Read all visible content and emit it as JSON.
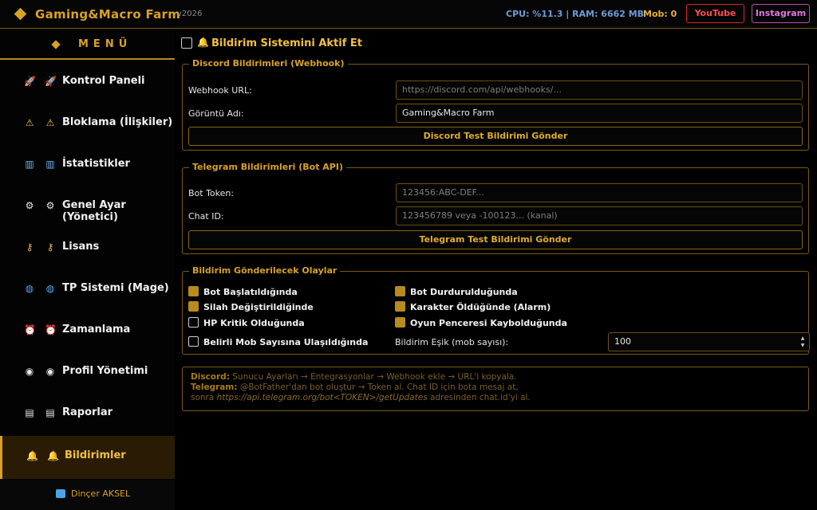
{
  "title_bar": {
    "app_title": "Gaming&Macro Farm",
    "version": "v2026",
    "cpu_ram": "CPU: %11.3 | RAM: 6662 MB",
    "mob": "Mob: 0",
    "youtube_label": "YouTube",
    "instagram_label": "Instagram"
  },
  "sidebar": {
    "menu_title": "MENÜ",
    "items": [
      {
        "icon": "rocket-icon",
        "label": "Kontrol Paneli"
      },
      {
        "icon": "warning-icon",
        "label": "Bloklama (İlişkiler)"
      },
      {
        "icon": "bar-chart-icon",
        "label": "İstatistikler"
      },
      {
        "icon": "gear-icon",
        "label": "Genel Ayar (Yönetici)"
      },
      {
        "icon": "key-icon",
        "label": "Lisans"
      },
      {
        "icon": "globe-icon",
        "label": "TP Sistemi (Mage)"
      },
      {
        "icon": "alarm-clock-icon",
        "label": "Zamanlama"
      },
      {
        "icon": "profile-icon",
        "label": "Profil Yönetimi"
      },
      {
        "icon": "clipboard-icon",
        "label": "Raporlar"
      },
      {
        "icon": "bell-icon",
        "label": "Bildirimler",
        "active": true
      }
    ],
    "user_name": "Dinçer AKSEL"
  },
  "main": {
    "enable_label": "Bildirim Sistemini Aktif Et",
    "enable_checked": false,
    "discord": {
      "title": "Discord Bildirimleri (Webhook)",
      "webhook_label": "Webhook URL:",
      "webhook_placeholder": "https://discord.com/api/webhooks/...",
      "display_name_label": "Görüntü Adı:",
      "display_name_value": "Gaming&Macro Farm",
      "test_button": "Discord Test Bildirimi Gönder"
    },
    "telegram": {
      "title": "Telegram Bildirimleri (Bot API)",
      "token_label": "Bot Token:",
      "token_placeholder": "123456:ABC-DEF...",
      "chat_id_label": "Chat ID:",
      "chat_id_placeholder": "123456789 veya -100123... (kanal)",
      "test_button": "Telegram Test Bildirimi Gönder"
    },
    "events": {
      "title": "Bildirim Gönderilecek Olaylar",
      "items": [
        {
          "label": "Bot Başlatıldığında",
          "checked": true
        },
        {
          "label": "Bot Durdurulduğunda",
          "checked": true
        },
        {
          "label": "Silah Değiştirildiğinde",
          "checked": true
        },
        {
          "label": "Karakter Öldüğünde (Alarm)",
          "checked": true
        },
        {
          "label": "HP Kritik Olduğunda",
          "checked": false
        },
        {
          "label": "Oyun Penceresi Kaybolduğunda",
          "checked": true
        },
        {
          "label": "Belirli Mob Sayısına Ulaşıldığında",
          "checked": false
        }
      ],
      "threshold_label": "Bildirim Eşik (mob sayısı):",
      "threshold_value": "100"
    },
    "info": {
      "discord_key": "Discord:",
      "discord_text": "Sunucu Ayarları → Entegrasyonlar → Webhook ekle → URL'i kopyala.",
      "telegram_key": "Telegram:",
      "telegram_text": "@BotFather'dan bot oluştur → Token al. Chat ID için bota mesaj at,",
      "line3_prefix": "sonra",
      "line3_url": "https://api.telegram.org/bot<TOKEN>/getUpdates",
      "line3_suffix": "adresinden chat.id'yi al."
    }
  }
}
